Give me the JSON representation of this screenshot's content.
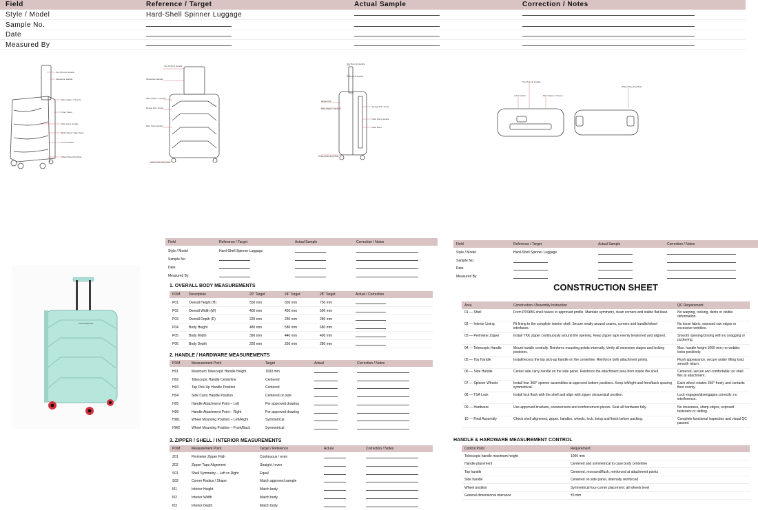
{
  "top_table": {
    "headers": [
      "Field",
      "Reference / Target",
      "Actual Sample",
      "Correction / Notes"
    ],
    "rows": [
      {
        "field": "Style / Model",
        "reference": "Hard-Shell Spinner Luggage"
      },
      {
        "field": "Sample No.",
        "reference": ""
      },
      {
        "field": "Date",
        "reference": ""
      },
      {
        "field": "Measured By",
        "reference": ""
      }
    ]
  },
  "drawing_callouts": {
    "view1": [
      "Top Pick-Up Handle",
      "Telescopic Handle",
      "Main Zipper / Closure",
      "Front Panel",
      "Side Carry Handle",
      "Corner Wheel",
      "Body Panel / Side Panel",
      "Wheel Mounting Plate"
    ],
    "view2": [
      "Top Pick-Up Handle",
      "Telescopic Handle",
      "Main Zipper / Closure",
      "Design Rib / Panel",
      "Side Carry Handle",
      "Wheel Mounting Plate"
    ],
    "view3": [
      "Top Pick-Up Handle",
      "Telescopic Handle",
      "Zipper Pull",
      "Main Zipper / Closure",
      "Design Rib / Panel",
      "Side Carry Handle",
      "Side Rivet",
      "Wheel Mounting Plate"
    ],
    "view4": [
      "Top Pick-Up Handle",
      "Label Holder",
      "Main Zipper / Closure",
      "Wheel Mounting Plate"
    ]
  },
  "left_form": {
    "headers": [
      "Field",
      "Reference / Target",
      "Actual Sample",
      "Correction / Notes"
    ],
    "rows": [
      {
        "field": "Style / Model",
        "reference": "Hard-Shell Spinner Luggage"
      },
      {
        "field": "Sample No.",
        "reference": ""
      },
      {
        "field": "Date",
        "reference": ""
      },
      {
        "field": "Measured By",
        "reference": ""
      }
    ]
  },
  "section1": {
    "title": "1. OVERALL BODY MEASUREMENTS",
    "headers": [
      "POM",
      "Description",
      "20\" Target",
      "24\" Target",
      "28\" Target",
      "Actual / Correction"
    ],
    "rows": [
      [
        "P01",
        "Overall Height (H)",
        "550 mm",
        "650 mm",
        "750 mm"
      ],
      [
        "P02",
        "Overall Width (W)",
        "400 mm",
        "450 mm",
        "500 mm"
      ],
      [
        "P03",
        "Overall Depth (D)",
        "220 mm",
        "250 mm",
        "280 mm"
      ],
      [
        "P04",
        "Body Height",
        "480 mm",
        "580 mm",
        "680 mm"
      ],
      [
        "P05",
        "Body Width",
        "390 mm",
        "440 mm",
        "490 mm"
      ],
      [
        "P06",
        "Body Depth",
        "220 mm",
        "250 mm",
        "280 mm"
      ]
    ]
  },
  "section2": {
    "title": "2. HANDLE / HARDWARE MEASUREMENTS",
    "headers": [
      "POM",
      "Measurement Point",
      "Target",
      "Actual",
      "Correction / Notes"
    ],
    "rows": [
      [
        "H01",
        "Maximum Telescopic Handle Height",
        "1000 mm"
      ],
      [
        "H02",
        "Telescopic Handle Centerline",
        "Centered"
      ],
      [
        "H03",
        "Top Pick-Up Handle Position",
        "Centered"
      ],
      [
        "H04",
        "Side Carry Handle Position",
        "Centered on side"
      ],
      [
        "H05",
        "Handle Attachment Point – Left",
        "Per approved drawing"
      ],
      [
        "H06",
        "Handle Attachment Point – Right",
        "Per approved drawing"
      ],
      [
        "HW1",
        "Wheel Mounting Position – Left/Right",
        "Symmetrical"
      ],
      [
        "HW2",
        "Wheel Mounting Position – Front/Back",
        "Symmetrical"
      ]
    ]
  },
  "section3": {
    "title": "3. ZIPPER / SHELL / INTERIOR MEASUREMENTS",
    "headers": [
      "POM",
      "Measurement Point",
      "Target / Reference",
      "Actual",
      "Correction / Notes"
    ],
    "rows": [
      [
        "Z01",
        "Perimeter Zipper Path",
        "Continuous / even"
      ],
      [
        "Z02",
        "Zipper Tape Alignment",
        "Straight / even"
      ],
      [
        "S01",
        "Shell Symmetry – Left vs Right",
        "Equal"
      ],
      [
        "S02",
        "Corner Radius / Shape",
        "Match approved sample"
      ],
      [
        "I01",
        "Interior Height",
        "Match body"
      ],
      [
        "I02",
        "Interior Width",
        "Match body"
      ],
      [
        "I03",
        "Interior Depth",
        "Match body"
      ]
    ]
  },
  "right_form": {
    "headers": [
      "Field",
      "Reference / Target",
      "Actual Sample",
      "Correction / Notes"
    ],
    "rows": [
      {
        "field": "Style / Model",
        "reference": "Hard-Shell Spinner Luggage"
      },
      {
        "field": "Sample No.",
        "reference": ""
      },
      {
        "field": "Date",
        "reference": ""
      },
      {
        "field": "Measured By",
        "reference": ""
      }
    ]
  },
  "construction": {
    "title": "CONSTRUCTION SHEET",
    "headers": [
      "Area",
      "Construction / Assembly Instruction",
      "QC Requirement"
    ],
    "rows": [
      [
        "01 — Shell",
        "Form PP/ABS shell halves to approved profile. Maintain symmetry, clean corners and stable flat base.",
        "No warping, rocking, dents or visible deformation."
      ],
      [
        "02 — Interior Lining",
        "Fit lining to the complete interior shell. Secure neatly around seams, corners and handle/wheel interfaces.",
        "No loose fabric, exposed raw edges or excessive wrinkles."
      ],
      [
        "03 — Perimeter Zipper",
        "Install YKK zipper continuously around the opening. Keep zipper tape evenly tensioned and aligned.",
        "Smooth opening/closing with no snagging or puckering."
      ],
      [
        "04 — Telescopic Handle",
        "Mount handle centrally. Reinforce mounting points internally. Verify all extension stages and locking positions.",
        "Max. handle height 1000 mm; no wobble; locks positively."
      ],
      [
        "05 — Top Handle",
        "Install/recess the top pick-up handle on the centerline. Reinforce both attachment points.",
        "Flush appearance, secure under lifting load, smooth return."
      ],
      [
        "06 — Side Handle",
        "Center side carry handle on the side panel. Reinforce the attachment area from inside the shell.",
        "Centered, secure and comfortable; no shell flex at attachment."
      ],
      [
        "07 — Spinner Wheels",
        "Install four 360° spinner assemblies at approved bottom positions. Keep left/right and front/back spacing symmetrical.",
        "Each wheel rotates 360° freely and contacts floor evenly."
      ],
      [
        "08 — TSA Lock",
        "Install lock flush with the shell and align with zipper closure/pull position.",
        "Lock engages/disengages correctly; no interference."
      ],
      [
        "09 — Hardware",
        "Use approved brackets, screws/rivets and reinforcement pieces. Seat all hardware fully.",
        "No looseness, sharp edges, exposed fasteners or rattling."
      ],
      [
        "10 — Final Assembly",
        "Check shell alignment, zipper, handles, wheels, lock, lining and finish before packing.",
        "Complete functional inspection and visual QC passed."
      ]
    ]
  },
  "handle_control": {
    "title": "HANDLE & HARDWARE MEASUREMENT CONTROL",
    "headers": [
      "Control Point",
      "Requirement"
    ],
    "rows": [
      [
        "Telescopic handle maximum height",
        "1000 mm"
      ],
      [
        "Handle placement",
        "Centered and symmetrical to case body centerline"
      ],
      [
        "Top handle",
        "Centered, recessed/flush, reinforced at attachment points"
      ],
      [
        "Side handle",
        "Centered on side panel, internally reinforced"
      ],
      [
        "Wheel position",
        "Symmetrical four-corner placement; all wheels level"
      ],
      [
        "General dimensional tolerance",
        "±3 mm"
      ]
    ]
  },
  "photo": {
    "brand": "SWISS BRAND",
    "body_color": "#b6e6dc",
    "wheel_color": "#d2323c"
  }
}
